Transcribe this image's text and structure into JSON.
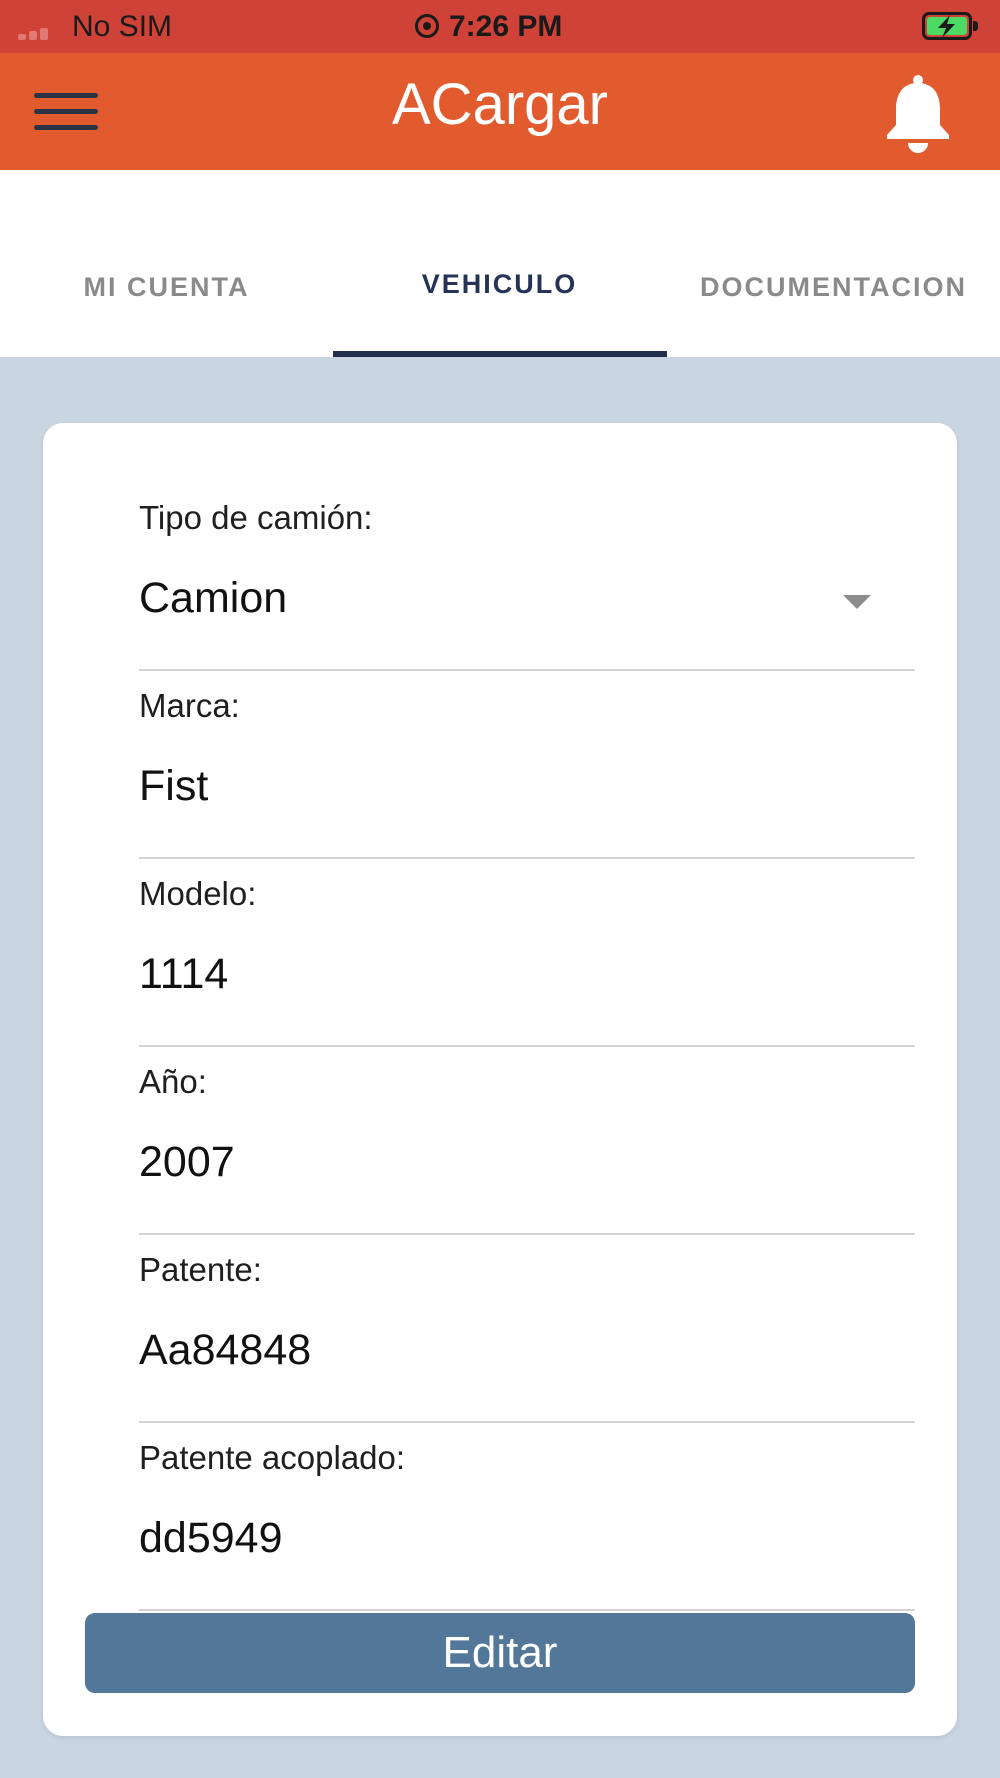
{
  "status_bar": {
    "carrier": "No SIM",
    "time": "7:26 PM",
    "battery_color": "#4cd964"
  },
  "app_bar": {
    "title": "ACargar",
    "menu_icon": "hamburger-icon",
    "notification_icon": "bell-icon",
    "background_color": "#e25b2e"
  },
  "tabs": [
    {
      "label": "MI CUENTA",
      "active": false
    },
    {
      "label": "VEHICULO",
      "active": true
    },
    {
      "label": "DOCUMENTACION",
      "active": false
    }
  ],
  "form": {
    "fields": [
      {
        "label": "Tipo de camión:",
        "value": "Camion",
        "type": "select"
      },
      {
        "label": "Marca:",
        "value": "Fist",
        "type": "text"
      },
      {
        "label": "Modelo:",
        "value": "1114",
        "type": "text"
      },
      {
        "label": "Año:",
        "value": "2007",
        "type": "text"
      },
      {
        "label": "Patente:",
        "value": "Aa84848",
        "type": "text"
      },
      {
        "label": "Patente acoplado:",
        "value": "dd5949",
        "type": "text"
      }
    ],
    "edit_button_label": "Editar",
    "button_color": "#527799"
  }
}
